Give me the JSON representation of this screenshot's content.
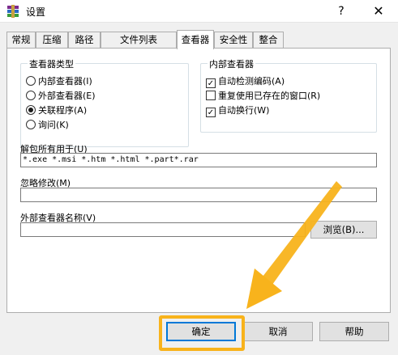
{
  "window": {
    "title": "设置",
    "help_glyph": "?",
    "close_glyph": "✕",
    "app_icon": "winrar-icon"
  },
  "tabs": [
    {
      "label": "常规"
    },
    {
      "label": "压缩"
    },
    {
      "label": "路径"
    },
    {
      "label": "文件列表"
    },
    {
      "label": "查看器",
      "active": true
    },
    {
      "label": "安全性"
    },
    {
      "label": "整合"
    }
  ],
  "viewer_type": {
    "title": "查看器类型",
    "options": [
      {
        "label": "内部查看器(I)",
        "selected": false
      },
      {
        "label": "外部查看器(E)",
        "selected": false
      },
      {
        "label": "关联程序(A)",
        "selected": true
      },
      {
        "label": "询问(K)",
        "selected": false
      }
    ]
  },
  "internal_viewer": {
    "title": "内部查看器",
    "options": [
      {
        "label": "自动检测编码(A)",
        "checked": true
      },
      {
        "label": "重复使用已存在的窗口(R)",
        "checked": false
      },
      {
        "label": "自动换行(W)",
        "checked": true
      }
    ]
  },
  "unpack_all": {
    "label": "解包所有用于(U)",
    "value": "*.exe *.msi *.htm *.html *.part*.rar"
  },
  "ignore_changes": {
    "label": "忽略修改(M)",
    "value": ""
  },
  "external_viewer": {
    "label": "外部查看器名称(V)",
    "value": "",
    "browse_label": "浏览(B)..."
  },
  "footer": {
    "ok_label": "确定",
    "cancel_label": "取消",
    "help_label": "帮助"
  },
  "colors": {
    "highlight": "#f8b31c",
    "default_button_border": "#0078d7"
  }
}
